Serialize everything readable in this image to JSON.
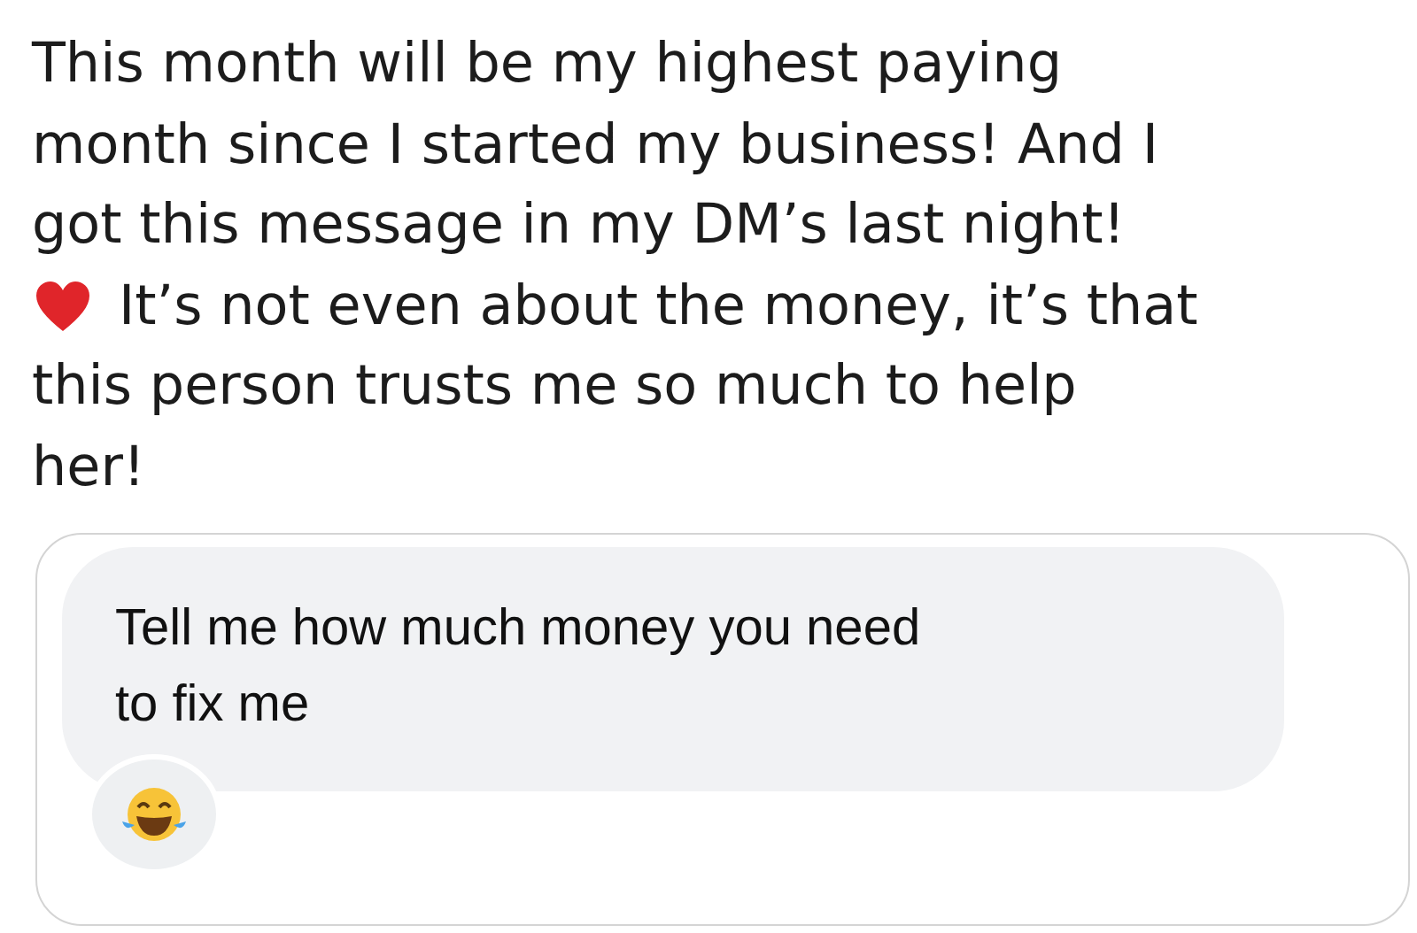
{
  "post": {
    "text": "This month will be my highest paying\nmonth since I started my business! And I\ngot this message in my DM’s last night!",
    "text_after_heart": "It’s not even about the money, it’s that",
    "text_continued": "this person trusts me so much to help\nher!"
  },
  "message": {
    "text": "Tell me how much money you need\nto fix me"
  }
}
